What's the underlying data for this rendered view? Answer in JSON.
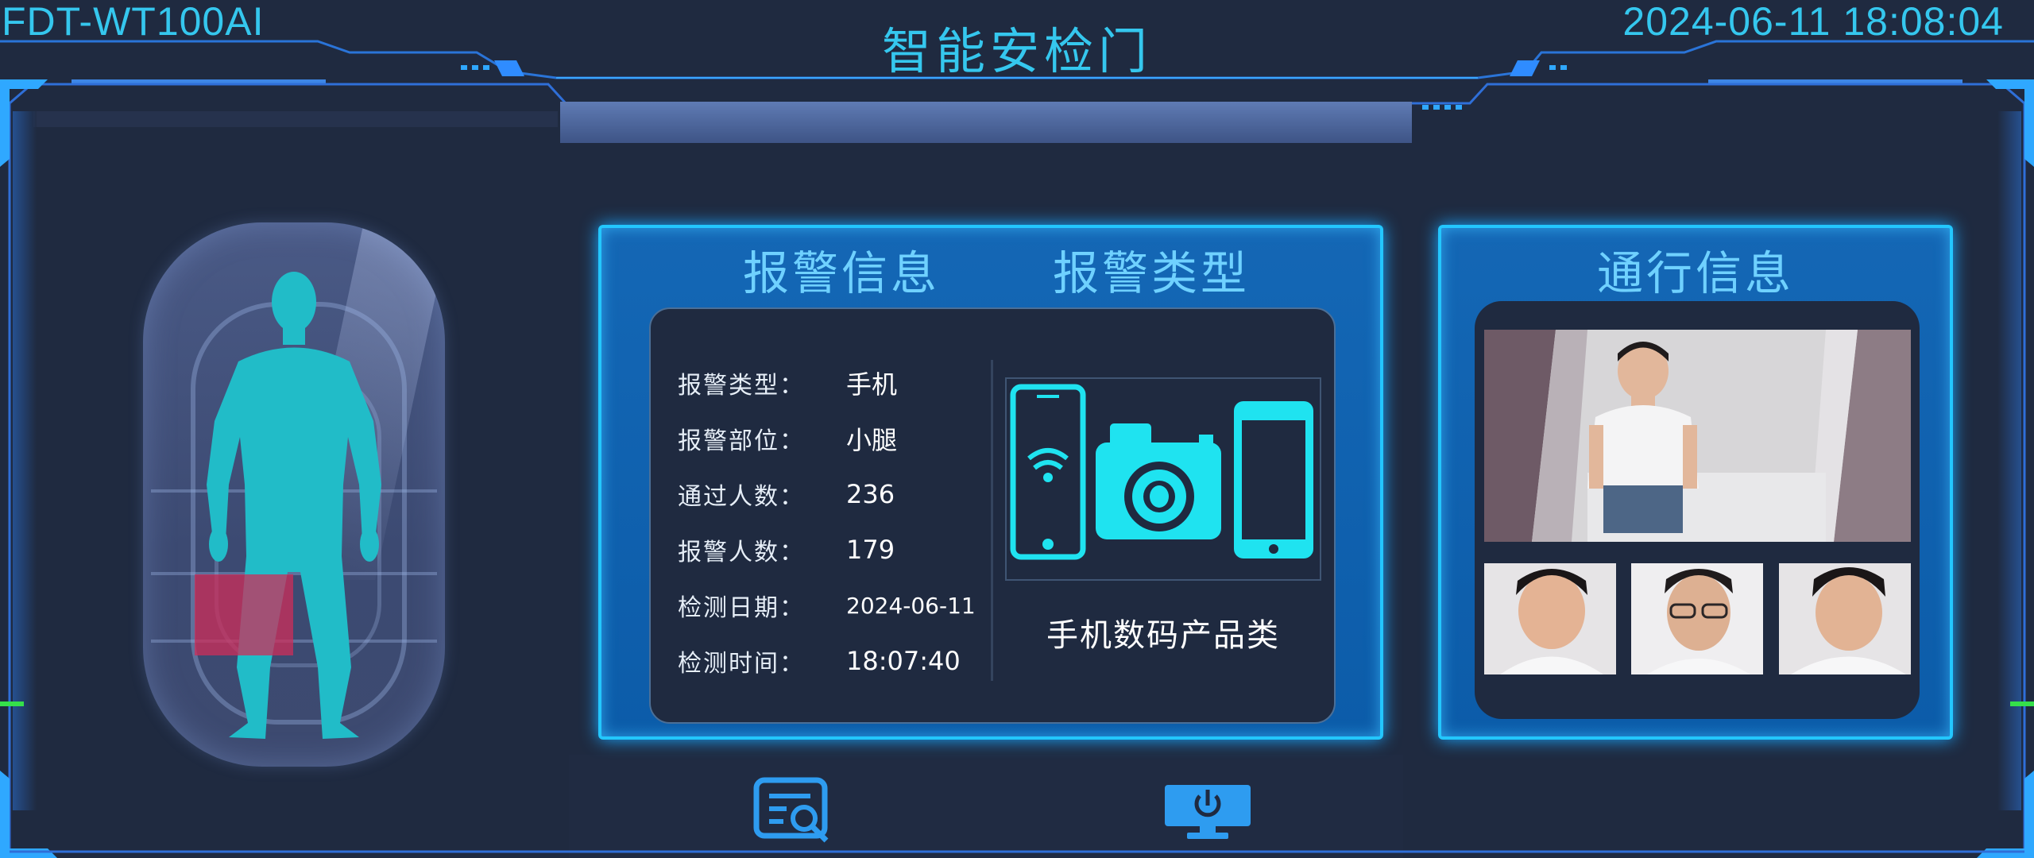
{
  "header": {
    "device_id": "FDT-WT100AI",
    "title": "智能安检门",
    "datetime": "2024-06-11 18:08:04"
  },
  "colors": {
    "accent": "#35c7ee",
    "panel_blue": "#0f61b0",
    "panel_glow": "#23c7ff",
    "background": "#1f2a40",
    "alarm_zone": "#cd2d5a",
    "icon_cyan": "#1fe3f0"
  },
  "body_scan": {
    "alarm_region": "小腿"
  },
  "alarm_panel": {
    "title_info": "报警信息",
    "title_type": "报警类型",
    "rows": [
      {
        "label": "报警类型：",
        "value": "手机"
      },
      {
        "label": "报警部位：",
        "value": "小腿"
      },
      {
        "label": "通过人数：",
        "value": "236"
      },
      {
        "label": "报警人数：",
        "value": "179"
      },
      {
        "label": "检测日期：",
        "value": "2024-06-11"
      },
      {
        "label": "检测时间：",
        "value": "18:07:40"
      }
    ],
    "type_icons": [
      "phone-wifi-icon",
      "camera-icon",
      "tablet-icon"
    ],
    "type_label": "手机数码产品类"
  },
  "pass_panel": {
    "title": "通行信息"
  },
  "bottom_bar": {
    "buttons": [
      "record-search-icon",
      "monitor-power-icon"
    ]
  }
}
